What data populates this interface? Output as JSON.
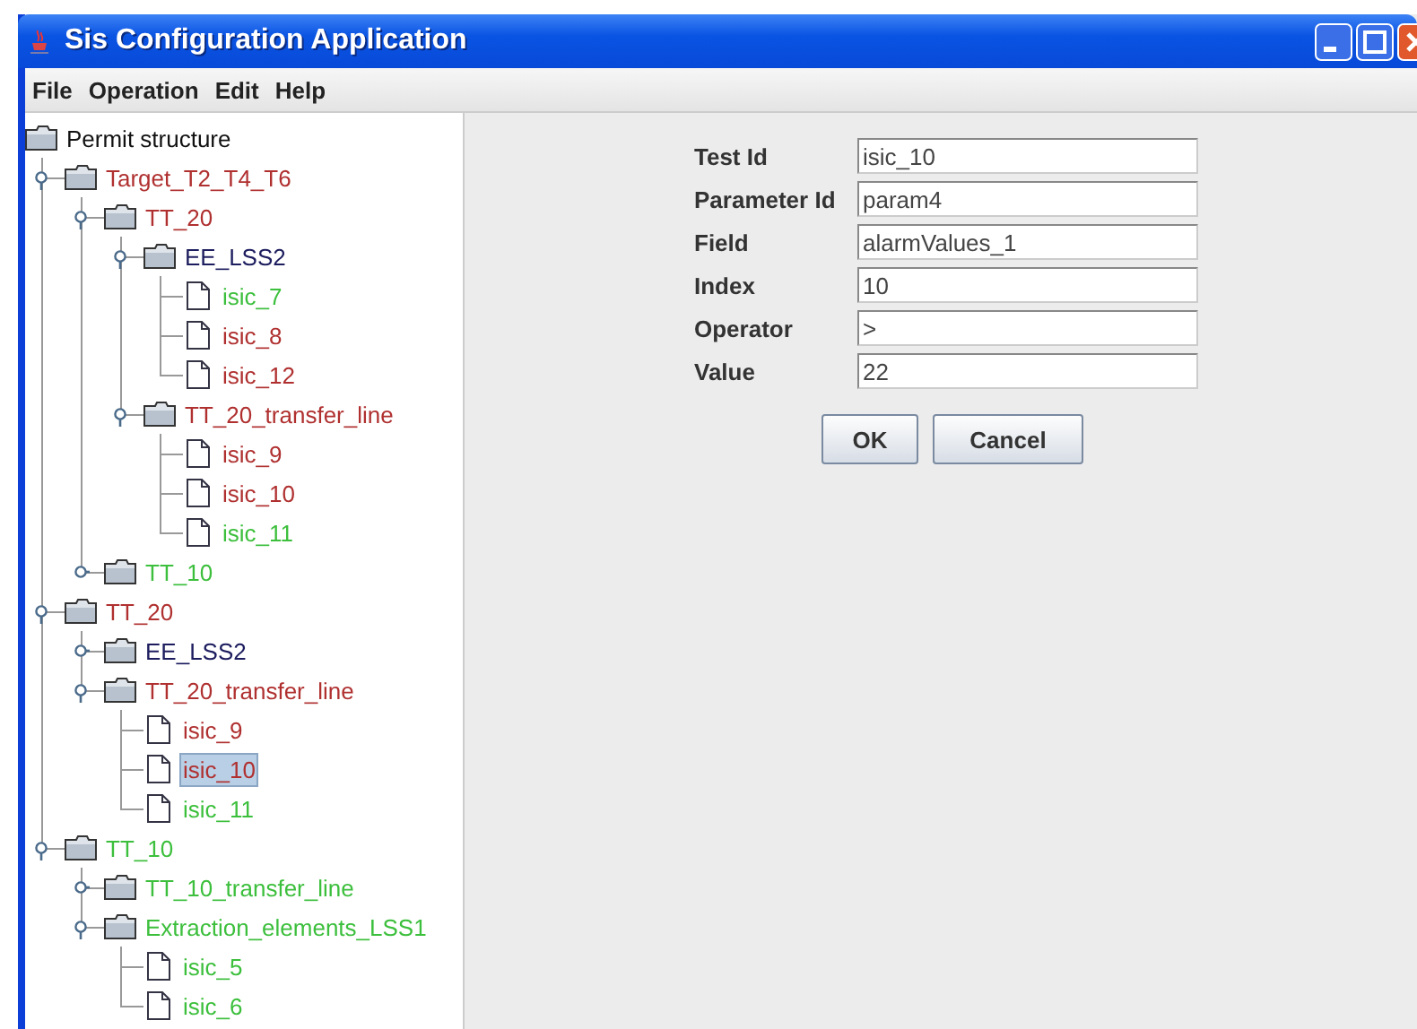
{
  "window": {
    "title": "Sis Configuration Application"
  },
  "menu": [
    "File",
    "Operation",
    "Edit",
    "Help"
  ],
  "tree": {
    "label": "Permit structure",
    "kind": "folder",
    "color": "#111111",
    "selected": false,
    "children": [
      {
        "label": "Target_T2_T4_T6",
        "kind": "folder",
        "color": "#b03030",
        "expanded": true,
        "selected": false,
        "children": [
          {
            "label": "TT_20",
            "kind": "folder",
            "color": "#b03030",
            "expanded": true,
            "selected": false,
            "children": [
              {
                "label": "EE_LSS2",
                "kind": "folder",
                "color": "#1c1c5e",
                "expanded": true,
                "selected": false,
                "children": [
                  {
                    "label": "isic_7",
                    "kind": "leaf",
                    "color": "#3cbf3c",
                    "selected": false
                  },
                  {
                    "label": "isic_8",
                    "kind": "leaf",
                    "color": "#b03030",
                    "selected": false
                  },
                  {
                    "label": "isic_12",
                    "kind": "leaf",
                    "color": "#b03030",
                    "selected": false
                  }
                ]
              },
              {
                "label": "TT_20_transfer_line",
                "kind": "folder",
                "color": "#b03030",
                "expanded": true,
                "selected": false,
                "children": [
                  {
                    "label": "isic_9",
                    "kind": "leaf",
                    "color": "#b03030",
                    "selected": false
                  },
                  {
                    "label": "isic_10",
                    "kind": "leaf",
                    "color": "#b03030",
                    "selected": false
                  },
                  {
                    "label": "isic_11",
                    "kind": "leaf",
                    "color": "#3cbf3c",
                    "selected": false
                  }
                ]
              }
            ]
          },
          {
            "label": "TT_10",
            "kind": "folder",
            "color": "#3cbf3c",
            "expanded": false,
            "selected": false
          }
        ]
      },
      {
        "label": "TT_20",
        "kind": "folder",
        "color": "#b03030",
        "expanded": true,
        "selected": false,
        "children": [
          {
            "label": "EE_LSS2",
            "kind": "folder",
            "color": "#1c1c5e",
            "expanded": false,
            "selected": false
          },
          {
            "label": "TT_20_transfer_line",
            "kind": "folder",
            "color": "#b03030",
            "expanded": true,
            "selected": false,
            "children": [
              {
                "label": "isic_9",
                "kind": "leaf",
                "color": "#b03030",
                "selected": false
              },
              {
                "label": "isic_10",
                "kind": "leaf",
                "color": "#b03030",
                "selected": true
              },
              {
                "label": "isic_11",
                "kind": "leaf",
                "color": "#3cbf3c",
                "selected": false
              }
            ]
          }
        ]
      },
      {
        "label": "TT_10",
        "kind": "folder",
        "color": "#3cbf3c",
        "expanded": true,
        "selected": false,
        "children": [
          {
            "label": "TT_10_transfer_line",
            "kind": "folder",
            "color": "#3cbf3c",
            "expanded": false,
            "selected": false
          },
          {
            "label": "Extraction_elements_LSS1",
            "kind": "folder",
            "color": "#3cbf3c",
            "expanded": true,
            "selected": false,
            "children": [
              {
                "label": "isic_5",
                "kind": "leaf",
                "color": "#3cbf3c",
                "selected": false
              },
              {
                "label": "isic_6",
                "kind": "leaf",
                "color": "#3cbf3c",
                "selected": false
              }
            ]
          }
        ]
      }
    ]
  },
  "form": {
    "fields": [
      {
        "label": "Test Id",
        "value": "isic_10"
      },
      {
        "label": "Parameter Id",
        "value": "param4"
      },
      {
        "label": "Field",
        "value": "alarmValues_1"
      },
      {
        "label": "Index",
        "value": "10"
      },
      {
        "label": "Operator",
        "value": ">"
      },
      {
        "label": "Value",
        "value": "22"
      }
    ],
    "buttons": [
      "OK",
      "Cancel"
    ]
  }
}
